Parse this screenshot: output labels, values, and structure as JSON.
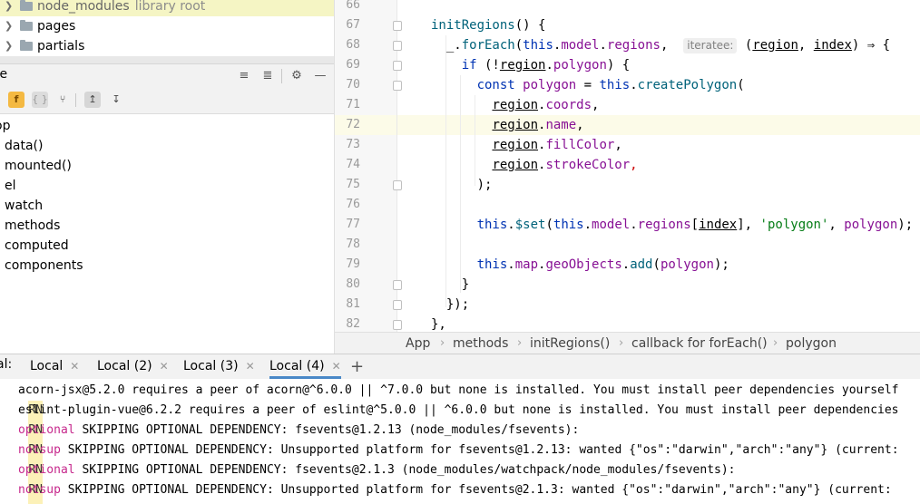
{
  "project_tree": {
    "items": [
      {
        "name": "node_modules",
        "hint": "library root"
      },
      {
        "name": "pages",
        "hint": ""
      },
      {
        "name": "partials",
        "hint": ""
      }
    ]
  },
  "structure": {
    "title": "re",
    "root": "op",
    "members": [
      "data()",
      "mounted()",
      "el",
      "watch",
      "methods",
      "computed",
      "components"
    ],
    "toolbar": {
      "func_label": "f",
      "obj_label": "{ }"
    }
  },
  "editor": {
    "line_numbers": [
      "66",
      "67",
      "68",
      "69",
      "70",
      "71",
      "72",
      "73",
      "74",
      "75",
      "76",
      "77",
      "78",
      "79",
      "80",
      "81",
      "82"
    ],
    "parameter_hint": "iteratee:"
  },
  "breadcrumb": [
    "App",
    "methods",
    "initRegions()",
    "callback for forEach()",
    "polygon"
  ],
  "terminal": {
    "label": "al:",
    "tabs": [
      "Local",
      "Local (2)",
      "Local (3)",
      "Local (4)"
    ],
    "active_tab": "Local (4)",
    "lines": [
      {
        "prefix": "RN",
        "level": "",
        "text": "acorn-jsx@5.2.0 requires a peer of acorn@^6.0.0 || ^7.0.0 but none is installed. You must install peer dependencies yourself"
      },
      {
        "prefix": "RN",
        "level": "",
        "text": "eslint-plugin-vue@6.2.2 requires a peer of eslint@^5.0.0 || ^6.0.0 but none is installed. You must install peer dependencies"
      },
      {
        "prefix": "RN",
        "level": "optional",
        "text": "SKIPPING OPTIONAL DEPENDENCY: fsevents@1.2.13 (node_modules/fsevents):"
      },
      {
        "prefix": "RN",
        "level": "notsup",
        "text": "SKIPPING OPTIONAL DEPENDENCY: Unsupported platform for fsevents@1.2.13: wanted {\"os\":\"darwin\",\"arch\":\"any\"} (current:"
      },
      {
        "prefix": "RN",
        "level": "optional",
        "text": "SKIPPING OPTIONAL DEPENDENCY: fsevents@2.1.3 (node_modules/watchpack/node_modules/fsevents):"
      },
      {
        "prefix": "RN",
        "level": "notsup",
        "text": "SKIPPING OPTIONAL DEPENDENCY: Unsupported platform for fsevents@2.1.3: wanted {\"os\":\"darwin\",\"arch\":\"any\"} (current:"
      }
    ]
  }
}
